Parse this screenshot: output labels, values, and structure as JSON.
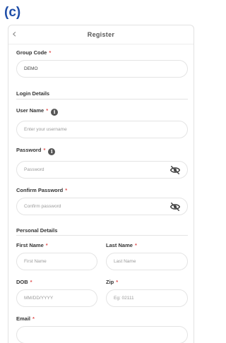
{
  "figure_label": "(c)",
  "nav": {
    "title": "Register",
    "back_glyph": "‹"
  },
  "required_marker": "*",
  "group_code": {
    "label": "Group Code",
    "value": "DEMO"
  },
  "sections": {
    "login": "Login Details",
    "personal": "Personal Details"
  },
  "user_name": {
    "label": "User Name",
    "placeholder": "Enter your username",
    "info_glyph": "i"
  },
  "password": {
    "label": "Password",
    "placeholder": "Password",
    "info_glyph": "i"
  },
  "confirm_password": {
    "label": "Confirm Password",
    "placeholder": "Confirm password"
  },
  "first_name": {
    "label": "First Name",
    "placeholder": "First Name"
  },
  "last_name": {
    "label": "Last Name",
    "placeholder": "Last Name"
  },
  "dob": {
    "label": "DOB",
    "placeholder": "MM/DD/YYYY"
  },
  "zip": {
    "label": "Zip",
    "placeholder": "Eg: 02111"
  },
  "email": {
    "label": "Email"
  },
  "icons": {
    "eye_off": "eye-slash-icon",
    "info": "info-icon",
    "back": "chevron-left-icon"
  }
}
